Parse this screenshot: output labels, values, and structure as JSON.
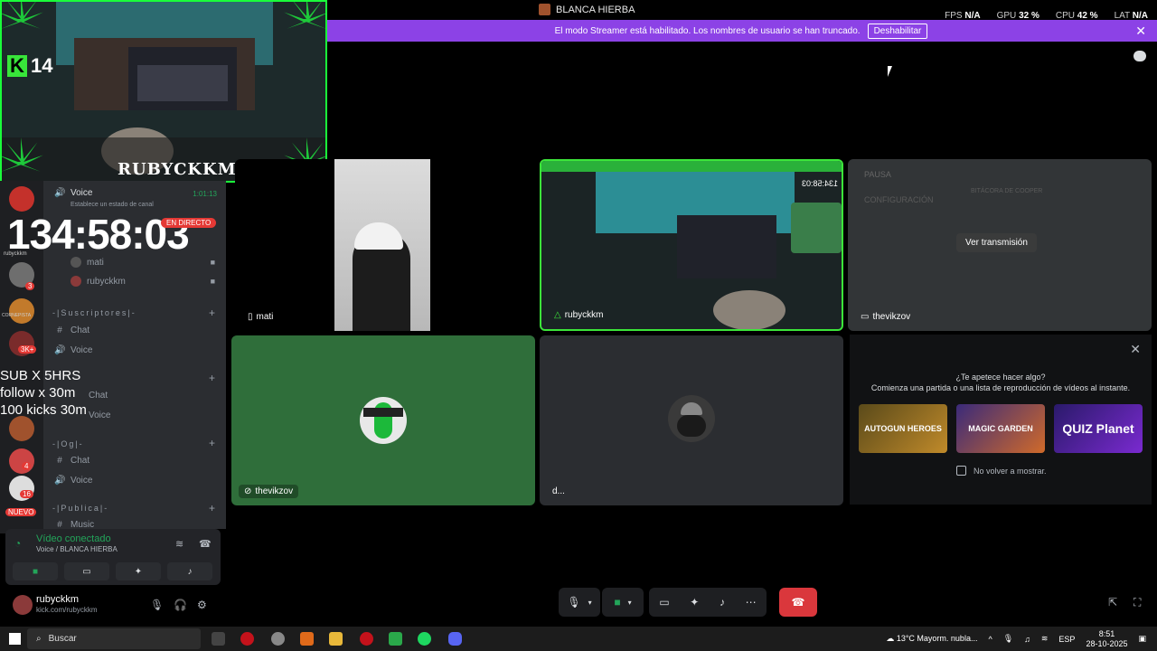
{
  "window": {
    "title": "BLANCA HIERBA",
    "stats": [
      {
        "label": "FPS",
        "value": "N/A"
      },
      {
        "label": "GPU",
        "value": "32 %"
      },
      {
        "label": "CPU",
        "value": "42 %"
      },
      {
        "label": "LAT",
        "value": "N/A"
      }
    ]
  },
  "banner": {
    "text": "El modo Streamer está habilitado. Los nombres de usuario se han truncado.",
    "button": "Deshabilitar"
  },
  "stream_overlay": {
    "kick_count": "14",
    "streamer_name": "RUBYCKKM",
    "big_timer": "134:58:03",
    "live_badge": "EN DIRECTO",
    "promo_lines": [
      "SUB X 5HRS",
      "follow x 30m",
      "100 kicks 30m"
    ]
  },
  "servers": {
    "badges": [
      "3",
      "3K+",
      "4",
      "16",
      "NUEVO"
    ],
    "labels": [
      "rubyckkm",
      "CORNEPISTA"
    ]
  },
  "channels": {
    "voice_top": {
      "name": "Voice",
      "timer": "1:01:13",
      "status": "Establece un estado de canal"
    },
    "voice_members": [
      "mati",
      "rubyckkm"
    ],
    "categories": [
      {
        "name": "-|Suscriptores|-",
        "items": [
          {
            "type": "text",
            "label": "Chat"
          },
          {
            "type": "voice",
            "label": "Voice"
          }
        ]
      },
      {
        "name": "",
        "items": [
          {
            "type": "text",
            "label": "Chat"
          },
          {
            "type": "voice",
            "label": "Voice"
          }
        ]
      },
      {
        "name": "-|Og|-",
        "items": [
          {
            "type": "text",
            "label": "Chat"
          },
          {
            "type": "voice",
            "label": "Voice"
          }
        ]
      },
      {
        "name": "-|Publica|-",
        "items": [
          {
            "type": "text",
            "label": "Music"
          }
        ]
      }
    ]
  },
  "voice_panel": {
    "status": "Vídeo conectado",
    "location": "Voice / BLANCA HIERBA"
  },
  "user": {
    "name": "rubyckkm",
    "status": "kick.com/rubyckkm"
  },
  "tiles": {
    "mati": "mati",
    "rubyckkm": "rubyckkm",
    "rubyckkm_timer": "134:58:03",
    "thevikzov_stream": "thevikzov",
    "watch_button": "Ver transmisión",
    "stream_preview": [
      "PAUSA",
      "CONFIGURACIÓN",
      "BITÁCORA DE COOPER"
    ],
    "thevikzov": "thevikzov",
    "d_user": "d..."
  },
  "activity": {
    "question": "¿Te apetece hacer algo?",
    "subtitle": "Comienza una partida o una lista de reproducción de vídeos al instante.",
    "games": [
      "AUTOGUN HEROES",
      "MAGIC GARDEN",
      "QUIZ Planet"
    ],
    "dont_show": "No volver a mostrar."
  },
  "taskbar": {
    "search": "Buscar",
    "weather": "13°C  Mayorm. nubla...",
    "lang": "ESP",
    "time": "8:51",
    "date": "28-10-2025"
  },
  "colors": {
    "banner": "#8c42e6",
    "hangup": "#da373c",
    "online_green": "#23a55a",
    "tile_green": "#2f6e3a"
  }
}
